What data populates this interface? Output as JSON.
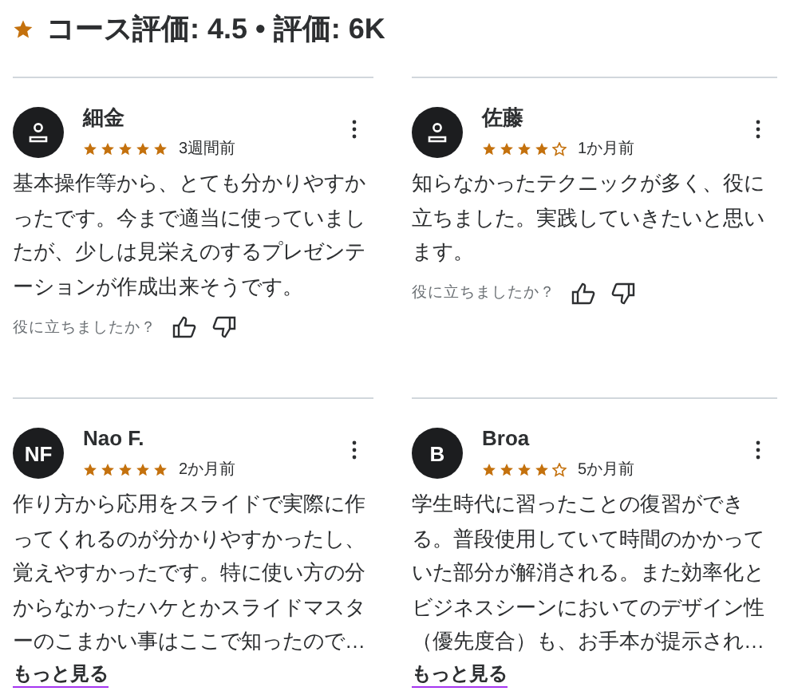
{
  "header": {
    "title": "コース評価: 4.5 • 評価: 6K"
  },
  "reviews": [
    {
      "avatar": {
        "kind": "icon"
      },
      "name": "細金",
      "stars": 5,
      "time": "3週間前",
      "body": "基本操作等から、とても分かりやすかったです。今まで適当に使っていましたが、少しは見栄えのするプレゼンテーションが作成出来そうです。",
      "helpful": "役に立ちましたか？"
    },
    {
      "avatar": {
        "kind": "icon"
      },
      "name": "佐藤",
      "stars": 4,
      "time": "1か月前",
      "body": "知らなかったテクニックが多く、役に立ちました。実践していきたいと思います。",
      "helpful": "役に立ちましたか？"
    },
    {
      "avatar": {
        "kind": "initials",
        "text": "NF"
      },
      "name": "Nao F.",
      "stars": 5,
      "time": "2か月前",
      "body": "作り方から応用をスライドで実際に作ってくれるのが分かりやすかったし、覚えやすかったです。特に使い方の分からなかったハケとかスライドマスターのこまかい事はここで知ったので…",
      "more": "もっと見る"
    },
    {
      "avatar": {
        "kind": "initials",
        "text": "B"
      },
      "name": "Broa",
      "stars": 4,
      "time": "5か月前",
      "body": "学生時代に習ったことの復習ができる。普段使用していて時間のかかっていた部分が解消される。また効率化とビジネスシーンにおいてのデザイン性（優先度合）も、お手本が提示され…",
      "more": "もっと見る"
    }
  ]
}
